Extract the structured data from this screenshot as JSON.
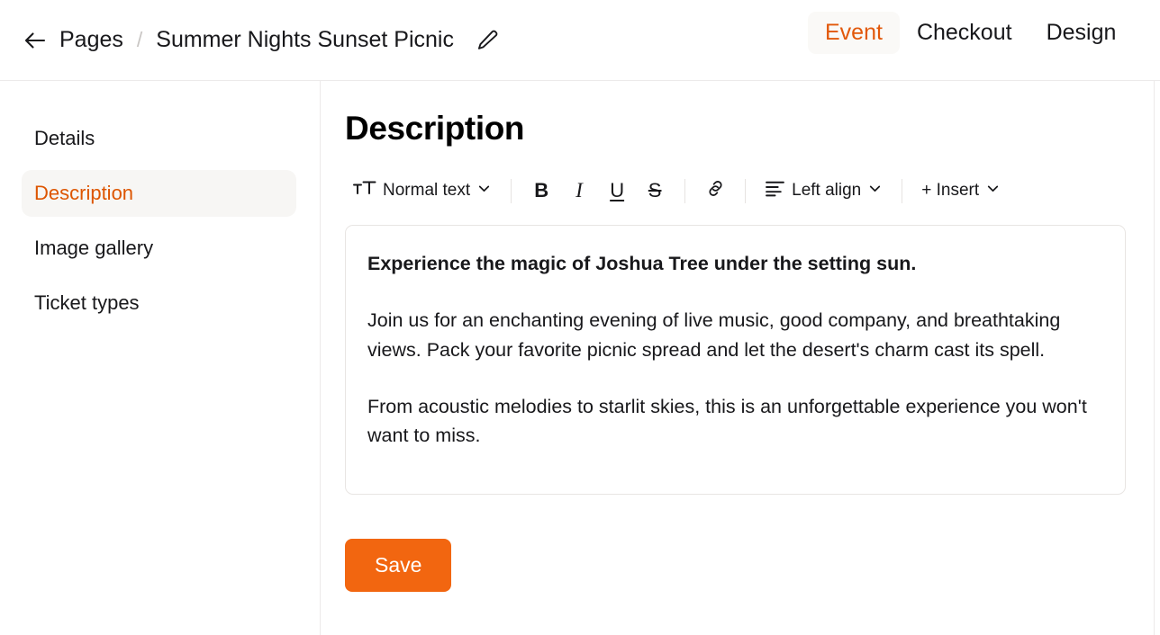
{
  "header": {
    "back_icon": "arrow-left-icon",
    "breadcrumb_root": "Pages",
    "breadcrumb_separator": "/",
    "page_name": "Summer Nights Sunset Picnic",
    "edit_icon": "pencil-icon",
    "tabs": [
      {
        "label": "Event",
        "active": true
      },
      {
        "label": "Checkout",
        "active": false
      },
      {
        "label": "Design",
        "active": false
      }
    ]
  },
  "sidebar": {
    "items": [
      {
        "label": "Details",
        "active": false
      },
      {
        "label": "Description",
        "active": true
      },
      {
        "label": "Image gallery",
        "active": false
      },
      {
        "label": "Ticket types",
        "active": false
      }
    ]
  },
  "main": {
    "title": "Description",
    "toolbar": {
      "text_style_icon": "text-style-icon",
      "text_style_label": "Normal text",
      "bold_label": "B",
      "italic_label": "I",
      "underline_label": "U",
      "strikethrough_label": "S",
      "link_icon": "link-icon",
      "align_icon": "align-left-icon",
      "align_label": "Left align",
      "insert_label": "+ Insert",
      "chevron_icon": "chevron-down-icon"
    },
    "editor": {
      "lead": "Experience the magic of Joshua Tree under the setting sun.",
      "paragraph_1": "Join us for an enchanting evening of live music, good company, and breathtaking views. Pack your favorite picnic spread and let the desert's charm cast its spell.",
      "paragraph_2": "From acoustic melodies to starlit skies, this is an unforgettable experience you won't want to miss."
    },
    "save_label": "Save"
  },
  "colors": {
    "accent_orange": "#f26610",
    "active_text_orange": "#dd5500",
    "tab_active_bg": "#faf9f7",
    "border": "#eceaea"
  }
}
